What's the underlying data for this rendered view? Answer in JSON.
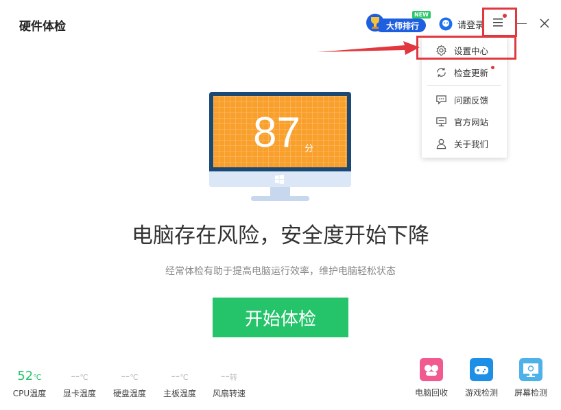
{
  "app": {
    "title": "硬件体检"
  },
  "toolbar": {
    "rank_label": "大师排行",
    "new_tag": "NEW",
    "login_label": "请登录"
  },
  "menu": {
    "items": [
      {
        "label": "设置中心",
        "icon": "gear-icon"
      },
      {
        "label": "检查更新",
        "icon": "refresh-icon"
      },
      {
        "label": "问题反馈",
        "icon": "chat-icon"
      },
      {
        "label": "官方网站",
        "icon": "monitor-icon"
      },
      {
        "label": "关于我们",
        "icon": "user-icon"
      }
    ]
  },
  "score": {
    "value": "87",
    "unit": "分"
  },
  "main": {
    "headline": "电脑存在风险，安全度开始下降",
    "subline": "经常体检有助于提高电脑运行效率，维护电脑轻松状态",
    "start_button": "开始体检"
  },
  "stats": [
    {
      "value": "52",
      "unit": "℃",
      "label": "CPU温度"
    },
    {
      "value": "--",
      "unit": "℃",
      "label": "显卡温度"
    },
    {
      "value": "--",
      "unit": "℃",
      "label": "硬盘温度"
    },
    {
      "value": "--",
      "unit": "℃",
      "label": "主板温度"
    },
    {
      "value": "--",
      "unit": "转",
      "label": "风扇转速"
    }
  ],
  "tools": [
    {
      "label": "电脑回收",
      "icon": "recycle-icon"
    },
    {
      "label": "游戏检测",
      "icon": "game-icon"
    },
    {
      "label": "屏幕检测",
      "icon": "screen-test-icon"
    }
  ],
  "colors": {
    "accent_green": "#25c46a",
    "screen_orange": "#f9a02c",
    "frame_navy": "#1c4874",
    "annotation_red": "#e0383e",
    "brand_blue": "#1e5ee0"
  }
}
